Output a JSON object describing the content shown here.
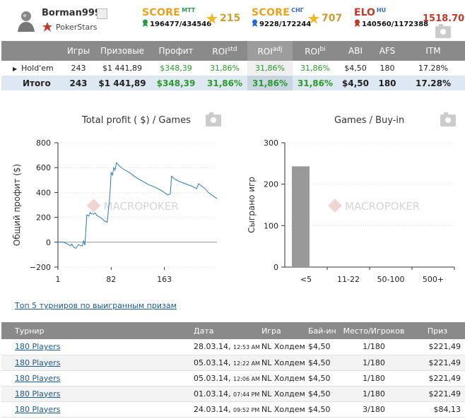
{
  "player": {
    "name": "Borman999",
    "room": "PokerStars"
  },
  "score_mtt": {
    "label": "SCORE",
    "sup": "MTT",
    "rank": "196477/434546",
    "stars": "215"
  },
  "score_sng": {
    "label": "SCORE",
    "sup": "СНГ",
    "rank": "9228/172244",
    "stars": "707"
  },
  "elo": {
    "label": "ELO",
    "sup": "HU",
    "rank": "140560/1172388",
    "value": "1518.70"
  },
  "stats": {
    "headers": [
      "",
      "Игры",
      "Призовые",
      "Профит",
      "ROI",
      "ROI",
      "ROI",
      "ABI",
      "AFS",
      "ITM"
    ],
    "roi_sups": [
      "std",
      "adj",
      "bi"
    ],
    "rows": [
      {
        "name": "Hold'em",
        "games": "243",
        "prize": "$1 441,89",
        "profit": "$348,39",
        "roi_std": "31,86%",
        "roi_adj": "31,86%",
        "roi_bi": "31,86%",
        "abi": "$4,50",
        "afs": "180",
        "itm": "17.28%"
      }
    ],
    "total": {
      "name": "Итого",
      "games": "243",
      "prize": "$1 441,89",
      "profit": "$348,39",
      "roi_std": "31,86%",
      "roi_adj": "31,86%",
      "roi_bi": "31,86%",
      "abi": "$4,50",
      "afs": "180",
      "itm": "17.28%"
    }
  },
  "chart_data": [
    {
      "type": "line",
      "title": "Total profit ( $) / Games",
      "ylabel": "Общий профит ($)",
      "xlabel": "",
      "x_ticks": [
        "1",
        "82",
        "163"
      ],
      "y_ticks": [
        "800",
        "600",
        "400",
        "200",
        "0",
        "−200"
      ],
      "ylim": [
        -200,
        800
      ],
      "xlim": [
        1,
        243
      ],
      "watermark": "MACROPOKER",
      "x": [
        1,
        8,
        14,
        20,
        22,
        25,
        28,
        32,
        35,
        38,
        40,
        42,
        45,
        48,
        50,
        52,
        55,
        58,
        60,
        62,
        65,
        68,
        72,
        76,
        80,
        82,
        84,
        86,
        88,
        90,
        95,
        100,
        110,
        120,
        130,
        140,
        150,
        160,
        168,
        172,
        174,
        178,
        185,
        195,
        205,
        212,
        215,
        220,
        225,
        230,
        235,
        243
      ],
      "y": [
        0,
        2,
        -10,
        -28,
        -15,
        -40,
        -50,
        -20,
        -25,
        -30,
        10,
        -25,
        220,
        210,
        240,
        230,
        225,
        235,
        215,
        210,
        200,
        190,
        170,
        160,
        380,
        560,
        540,
        600,
        580,
        640,
        610,
        590,
        560,
        520,
        490,
        460,
        440,
        410,
        380,
        390,
        530,
        510,
        490,
        470,
        450,
        430,
        470,
        450,
        430,
        400,
        380,
        350
      ]
    },
    {
      "type": "bar",
      "title": "Games / Buy-in",
      "ylabel": "Сыграно игр",
      "xlabel": "",
      "categories": [
        "<5",
        "11-22",
        "50-100",
        "500+"
      ],
      "values": [
        243,
        0,
        0,
        0
      ],
      "y_ticks": [
        "300",
        "200",
        "100",
        "0"
      ],
      "ylim": [
        0,
        300
      ],
      "watermark": "MACROPOKER"
    }
  ],
  "top_link": "Топ 5 турниров по выигранным призам",
  "tournaments": {
    "headers": [
      "Турнир",
      "Дата",
      "Игра",
      "Бай-ин",
      "Место/Игроков",
      "Приз"
    ],
    "rows": [
      {
        "name": "180 Players",
        "date": "28.03.14,",
        "time": "12:53 AM",
        "game": "NL Холдем",
        "buyin": "$4,50",
        "place": "1/180",
        "prize": "$221,49"
      },
      {
        "name": "180 Players",
        "date": "05.03.14,",
        "time": "12:22 AM",
        "game": "NL Холдем",
        "buyin": "$4,50",
        "place": "1/180",
        "prize": "$221,49"
      },
      {
        "name": "180 Players",
        "date": "05.03.14,",
        "time": "12:06 AM",
        "game": "NL Холдем",
        "buyin": "$4,50",
        "place": "1/180",
        "prize": "$221,49"
      },
      {
        "name": "180 Players",
        "date": "01.03.14,",
        "time": "07:44 PM",
        "game": "NL Холдем",
        "buyin": "$4,50",
        "place": "1/180",
        "prize": "$221,49"
      },
      {
        "name": "180 Players",
        "date": "24.03.14,",
        "time": "09:52 PM",
        "game": "NL Холдем",
        "buyin": "$4,50",
        "place": "3/180",
        "prize": "$84,13"
      }
    ]
  },
  "colors": {
    "header_bg": "#8a8a8a",
    "total_bg": "#dde8f2",
    "green": "#2a9a2a",
    "score": "#e8a11c",
    "elo": "#c0392b",
    "line": "#2a7ab0",
    "bar": "#999999"
  }
}
